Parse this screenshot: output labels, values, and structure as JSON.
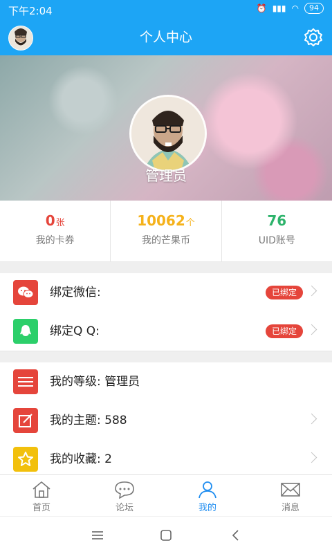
{
  "status": {
    "time": "下午2:04",
    "battery": "94"
  },
  "header": {
    "title": "个人中心"
  },
  "profile": {
    "name": "管理员"
  },
  "stats": [
    {
      "value": "0",
      "unit": "张",
      "label": "我的卡券",
      "color": "#e5453b"
    },
    {
      "value": "10062",
      "unit": "个",
      "label": "我的芒果币",
      "color": "#f5b21b"
    },
    {
      "value": "76",
      "unit": "",
      "label": "UID账号",
      "color": "#2db36b"
    }
  ],
  "bindings": {
    "wechat": {
      "label": "绑定微信:",
      "badge": "已绑定"
    },
    "qq": {
      "label": "绑定Q Q:",
      "badge": "已绑定"
    }
  },
  "menu": {
    "level": {
      "label": "我的等级: 管理员"
    },
    "topics": {
      "label": "我的主题: 588"
    },
    "favorites": {
      "label": "我的收藏: 2"
    }
  },
  "tabs": [
    {
      "label": "首页",
      "icon": "home-icon"
    },
    {
      "label": "论坛",
      "icon": "chat-bubble-icon"
    },
    {
      "label": "我的",
      "icon": "person-icon",
      "active": true
    },
    {
      "label": "消息",
      "icon": "mail-icon"
    }
  ],
  "colors": {
    "primary": "#1da5f5",
    "wechat": "#e5453b",
    "qq": "#2ccf6a",
    "level": "#e5453b",
    "topics": "#e5453b",
    "favorites": "#f2c00c"
  }
}
